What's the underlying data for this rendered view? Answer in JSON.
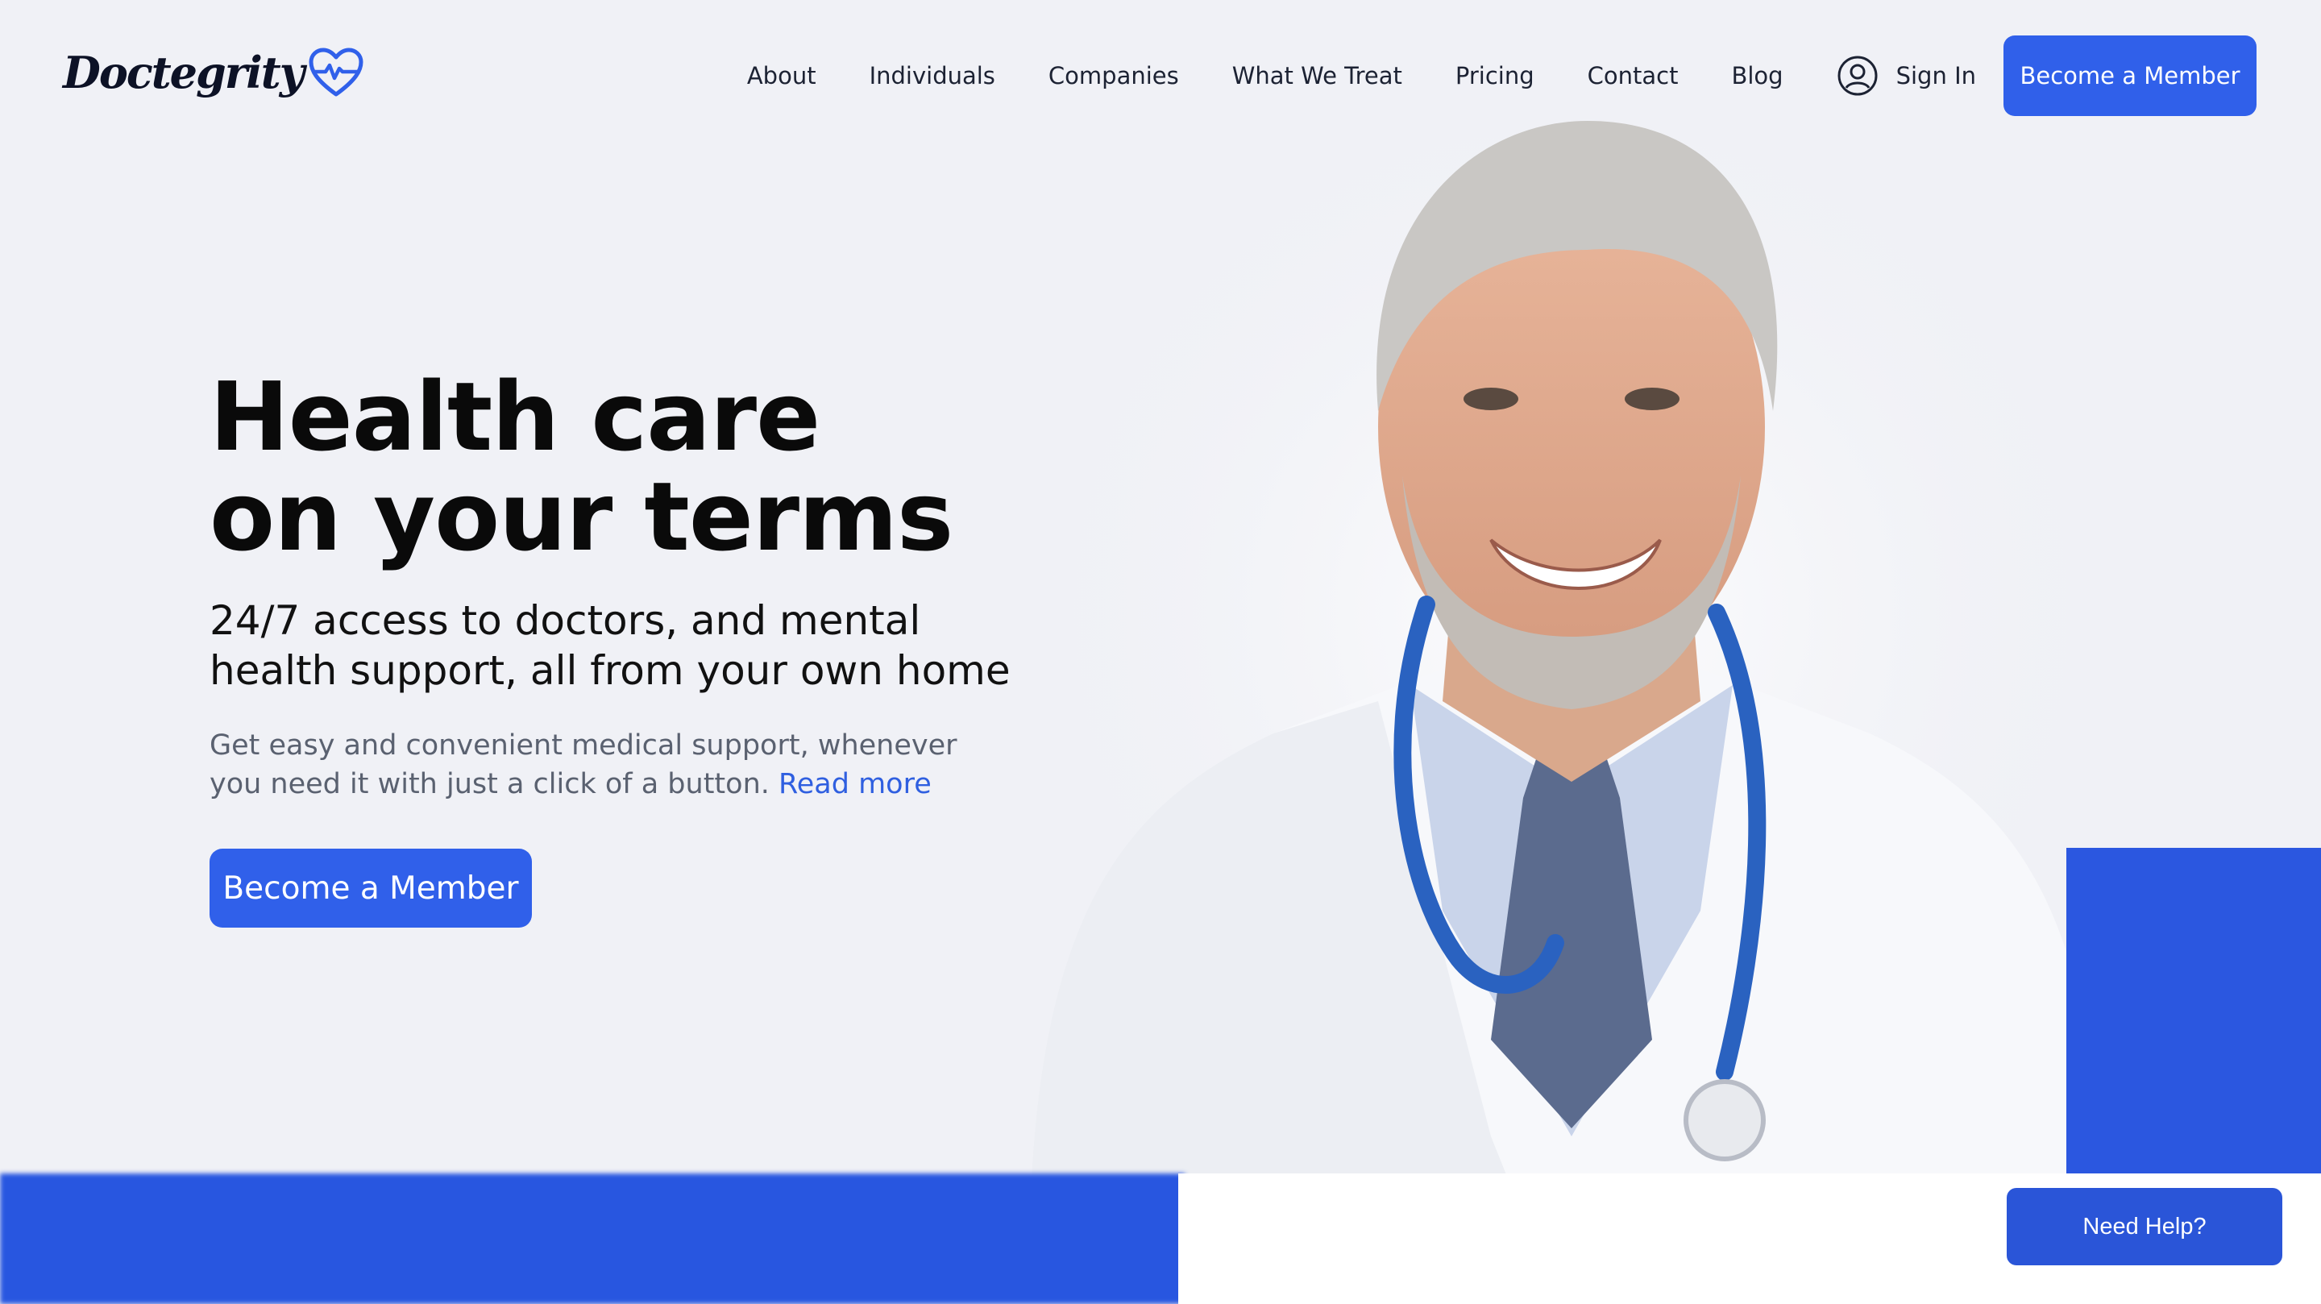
{
  "brand": {
    "name": "Doctegrity",
    "accent": "#3060ea"
  },
  "nav": {
    "links": [
      "About",
      "Individuals",
      "Companies",
      "What We Treat",
      "Pricing",
      "Contact",
      "Blog"
    ],
    "sign_in": "Sign In",
    "cta": "Become a Member"
  },
  "hero": {
    "headline_line1": "Health care",
    "headline_line2": "on your terms",
    "subheadline_line1": "24/7 access to doctors, and mental",
    "subheadline_line2": "health support, all from your own home",
    "body": "Get easy and convenient medical support, whenever you need it with just a click of a button.",
    "read_more": "Read more",
    "cta": "Become a Member"
  },
  "help": {
    "label": "Need Help?"
  },
  "icons": {
    "logo": "heart-pulse-icon",
    "sign_in": "user-circle-icon"
  },
  "colors": {
    "page_bg": "#f0f1f6",
    "primary": "#3060ea",
    "block": "#2b57e0",
    "help": "#2a55d8"
  }
}
